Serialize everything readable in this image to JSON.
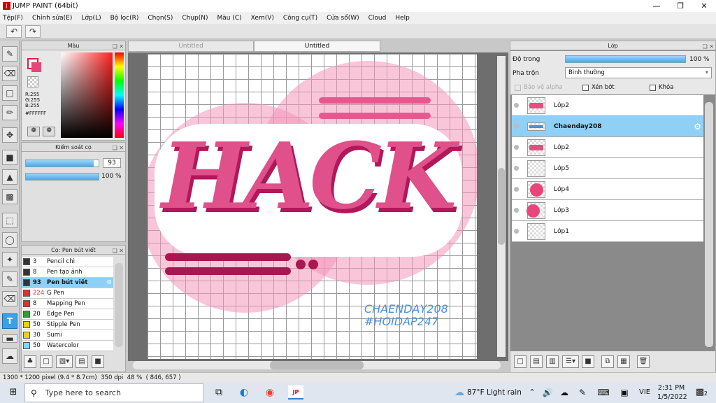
{
  "window": {
    "title": "JUMP PAINT (64bit)"
  },
  "menu": [
    "Tệp(F)",
    "Chỉnh sửa(E)",
    "Lớp(L)",
    "Bộ lọc(R)",
    "Chọn(S)",
    "Chụp(N)",
    "Màu (C)",
    "Xem(V)",
    "Công cụ(T)",
    "Cửa sổ(W)",
    "Cloud",
    "Help"
  ],
  "color_panel": {
    "title": "Màu",
    "r": "R:255",
    "g": "G:255",
    "b": "B:255",
    "hex": "#FFFFFF",
    "primary": "#ffffff",
    "secondary": "#e8457a"
  },
  "brush_control": {
    "title": "Kiểm soát cọ",
    "size_value": "93",
    "opacity_label": "100 %",
    "size_fraction": 0.93,
    "opacity_fraction": 1.0
  },
  "brush_panel": {
    "title": "Cọ: Pen bút viết",
    "items": [
      {
        "size": "3",
        "name": "Pencil chì",
        "color": "#333333"
      },
      {
        "size": "8",
        "name": "Pen tạo ảnh",
        "color": "#333333"
      },
      {
        "size": "93",
        "name": "Pen bút viết",
        "color": "#333333",
        "selected": true
      },
      {
        "size": "224",
        "name": "G Pen",
        "color": "#e03030"
      },
      {
        "size": "8",
        "name": "Mapping Pen",
        "color": "#e03030"
      },
      {
        "size": "20",
        "name": "Edge Pen",
        "color": "#30a030"
      },
      {
        "size": "50",
        "name": "Stipple Pen",
        "color": "#e8d020"
      },
      {
        "size": "30",
        "name": "Sumi",
        "color": "#e8d020"
      },
      {
        "size": "50",
        "name": "Watercolor",
        "color": "#80d8f8"
      }
    ]
  },
  "tabs": [
    "Untitled",
    "Untitled"
  ],
  "canvas": {
    "headline": "HACK",
    "credit1": "CHAENDAY208",
    "credit2": "#HOIDAP247"
  },
  "layer_panel": {
    "title": "Lớp",
    "opacity_label": "Độ trong",
    "opacity_value": "100 %",
    "opacity_fraction": 1.0,
    "blend_label": "Pha trộn",
    "blend_value": "Bình thường",
    "protect_alpha": "Bảo vệ alpha",
    "clipping": "Xén bớt",
    "lock": "Khóa",
    "layers": [
      {
        "name": "Lớp2",
        "thumb": "text"
      },
      {
        "name": "Chaenday208",
        "thumb": "credit",
        "selected": true
      },
      {
        "name": "Lớp2",
        "thumb": "text"
      },
      {
        "name": "Lớp5",
        "thumb": "empty"
      },
      {
        "name": "Lớp4",
        "thumb": "circle"
      },
      {
        "name": "Lớp3",
        "thumb": "circle-left"
      },
      {
        "name": "Lớp1",
        "thumb": "empty"
      }
    ]
  },
  "status": {
    "size": "1300 * 1200 pixel",
    "cm": "(9.4 * 8.7cm)",
    "dpi": "350 dpi",
    "zoom": "48 %",
    "coords": "( 846, 657 )"
  },
  "taskbar": {
    "search_placeholder": "Type here to search",
    "weather": "87°F  Light rain",
    "lang": "VIE",
    "time": "2:31 PM",
    "date": "1/5/2022",
    "notif": "2"
  }
}
